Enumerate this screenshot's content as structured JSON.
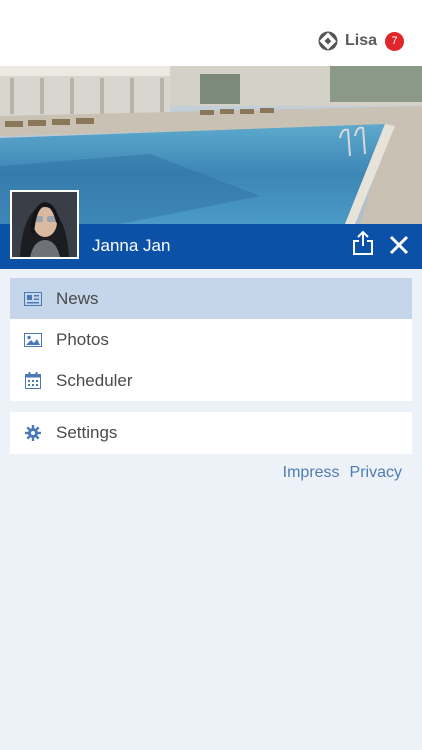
{
  "header": {
    "brand_name": "Lisa",
    "notification_count": "7",
    "brand_icon": "circle-logo-icon"
  },
  "profile": {
    "name": "Janna Jan",
    "share_icon": "share-icon",
    "close_icon": "close-icon"
  },
  "menu": {
    "items": [
      {
        "label": "News",
        "icon": "news-icon",
        "active": true
      },
      {
        "label": "Photos",
        "icon": "photo-icon",
        "active": false
      },
      {
        "label": "Scheduler",
        "icon": "calendar-icon",
        "active": false
      }
    ],
    "settings_label": "Settings",
    "settings_icon": "gear-icon"
  },
  "footer": {
    "impress_label": "Impress",
    "privacy_label": "Privacy"
  },
  "colors": {
    "primary": "#0b51a8",
    "active_item": "#c5d6ea",
    "badge": "#e0262b",
    "link": "#4f7db0",
    "background": "#edf1f8"
  }
}
